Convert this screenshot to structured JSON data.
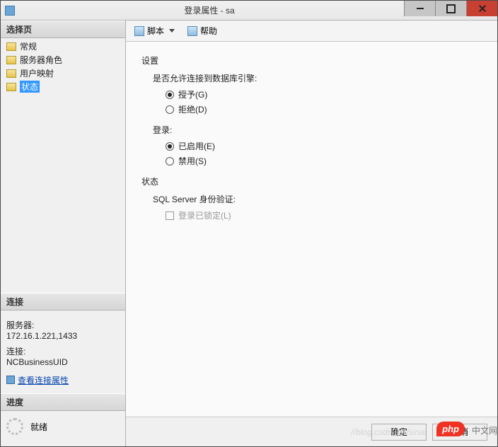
{
  "window": {
    "title": "登录属性 - sa"
  },
  "sidebar": {
    "select_page_header": "选择页",
    "items": [
      {
        "label": "常规"
      },
      {
        "label": "服务器角色"
      },
      {
        "label": "用户映射"
      },
      {
        "label": "状态"
      }
    ],
    "connection_header": "连接",
    "server_label": "服务器:",
    "server_value": "172.16.1.221,1433",
    "conn_label": "连接:",
    "conn_value": "NCBusinessUID",
    "view_conn_props": "查看连接属性",
    "progress_header": "进度",
    "progress_status": "就绪"
  },
  "toolbar": {
    "script": "脚本",
    "help": "帮助"
  },
  "content": {
    "settings_title": "设置",
    "q1": "是否允许连接到数据库引擎:",
    "q1_opt_grant": "授予(G)",
    "q1_opt_deny": "拒绝(D)",
    "q2": "登录:",
    "q2_opt_enabled": "已启用(E)",
    "q2_opt_disabled": "禁用(S)",
    "status_title": "状态",
    "sql_auth_label": "SQL Server 身份验证:",
    "login_locked": "登录已锁定(L)"
  },
  "footer": {
    "ok": "确定",
    "cancel": "取消",
    "watermark": "//blog.csdn.net/sinat",
    "badge": "php",
    "badge_text": "中文网"
  }
}
